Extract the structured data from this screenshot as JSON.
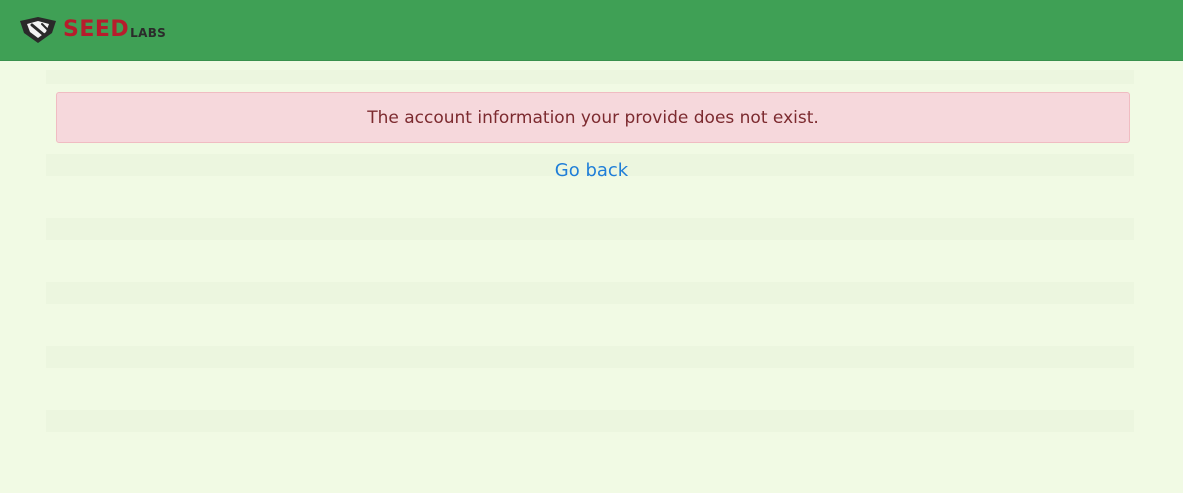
{
  "navbar": {
    "logo_main": "SEED",
    "logo_sub": "LABS",
    "logo_icon": "seedlabs-logo-icon",
    "background_color": "#3fa055",
    "logo_red": "#b71c2c"
  },
  "alert": {
    "message": "The account information your provide does not exist.",
    "background_color": "#f6d8dc",
    "text_color": "#7c2a2f"
  },
  "go_back": {
    "label": "Go back",
    "color": "#1f7ed8"
  },
  "page": {
    "background_color": "#f1fae4"
  }
}
